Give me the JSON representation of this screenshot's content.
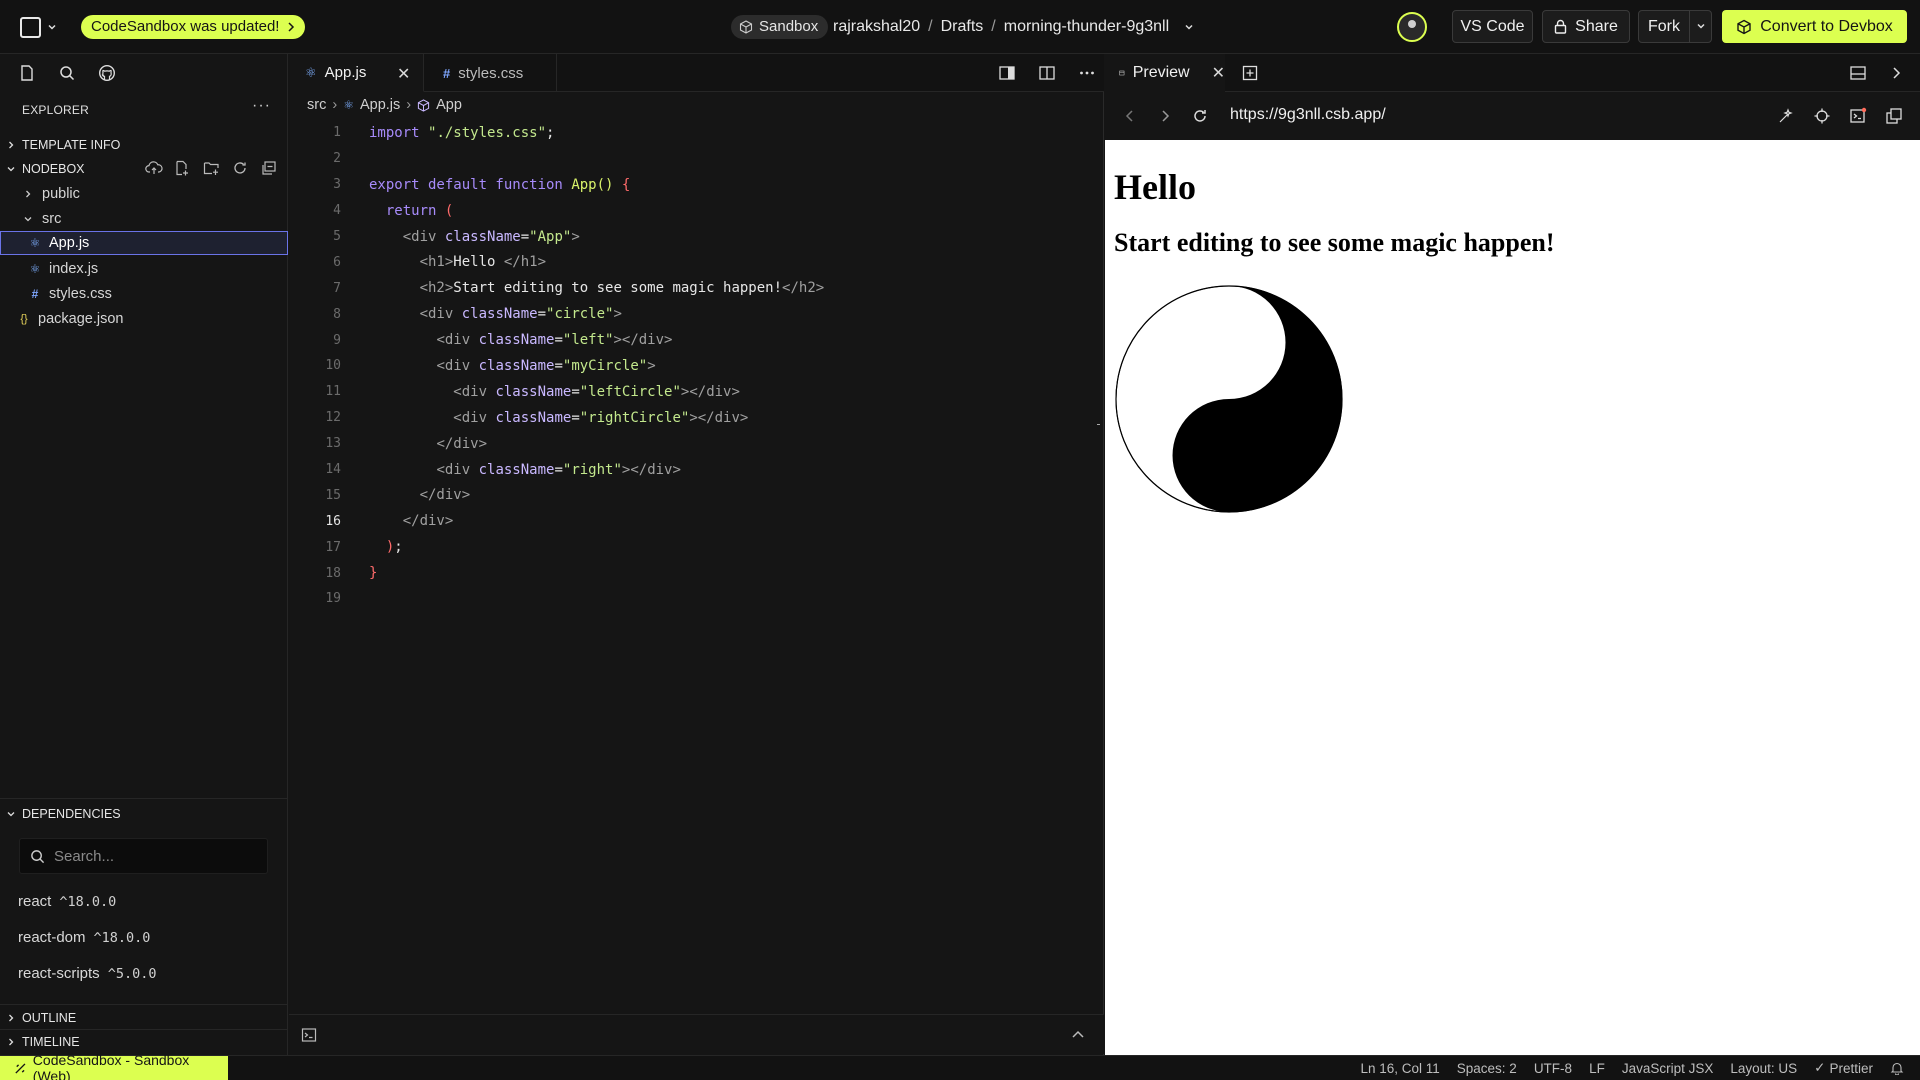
{
  "topbar": {
    "update_notice": "CodeSandbox was updated!",
    "sandbox_label": "Sandbox",
    "breadcrumb": {
      "user": "rajrakshal20",
      "folder": "Drafts",
      "sandbox_name": "morning-thunder-9g3nll"
    },
    "vscode_label": "VS Code",
    "share_label": "Share",
    "fork_label": "Fork",
    "convert_label": "Convert to Devbox",
    "accent_color": "#dcff50"
  },
  "sidebar": {
    "explorer_title": "EXPLORER",
    "template_info": "TEMPLATE INFO",
    "nodebox": "NODEBOX",
    "tree": [
      {
        "label": "public",
        "type": "folder-collapsed"
      },
      {
        "label": "src",
        "type": "folder-expanded"
      },
      {
        "label": "App.js",
        "type": "react-file",
        "selected": true
      },
      {
        "label": "index.js",
        "type": "react-file"
      },
      {
        "label": "styles.css",
        "type": "css-file"
      },
      {
        "label": "package.json",
        "type": "json-file"
      }
    ],
    "dependencies_title": "DEPENDENCIES",
    "search_placeholder": "Search...",
    "dependencies": [
      {
        "name": "react",
        "version": "^18.0.0"
      },
      {
        "name": "react-dom",
        "version": "^18.0.0"
      },
      {
        "name": "react-scripts",
        "version": "^5.0.0"
      }
    ],
    "outline": "OUTLINE",
    "timeline": "TIMELINE"
  },
  "editor": {
    "tabs": [
      {
        "label": "App.js",
        "active": true
      },
      {
        "label": "styles.css",
        "active": false
      }
    ],
    "breadcrumb": {
      "folder": "src",
      "file": "App.js",
      "symbol": "App"
    },
    "current_line": 16
  },
  "preview": {
    "tab_label": "Preview",
    "url": "https://9g3nll.csb.app/",
    "heading": "Hello",
    "subheading": "Start editing to see some magic happen!"
  },
  "statusbar": {
    "remote": "CodeSandbox - Sandbox (Web)",
    "position": "Ln 16, Col 11",
    "spaces": "Spaces: 2",
    "encoding": "UTF-8",
    "eol": "LF",
    "language": "JavaScript JSX",
    "layout": "Layout: US",
    "formatter": "Prettier"
  }
}
